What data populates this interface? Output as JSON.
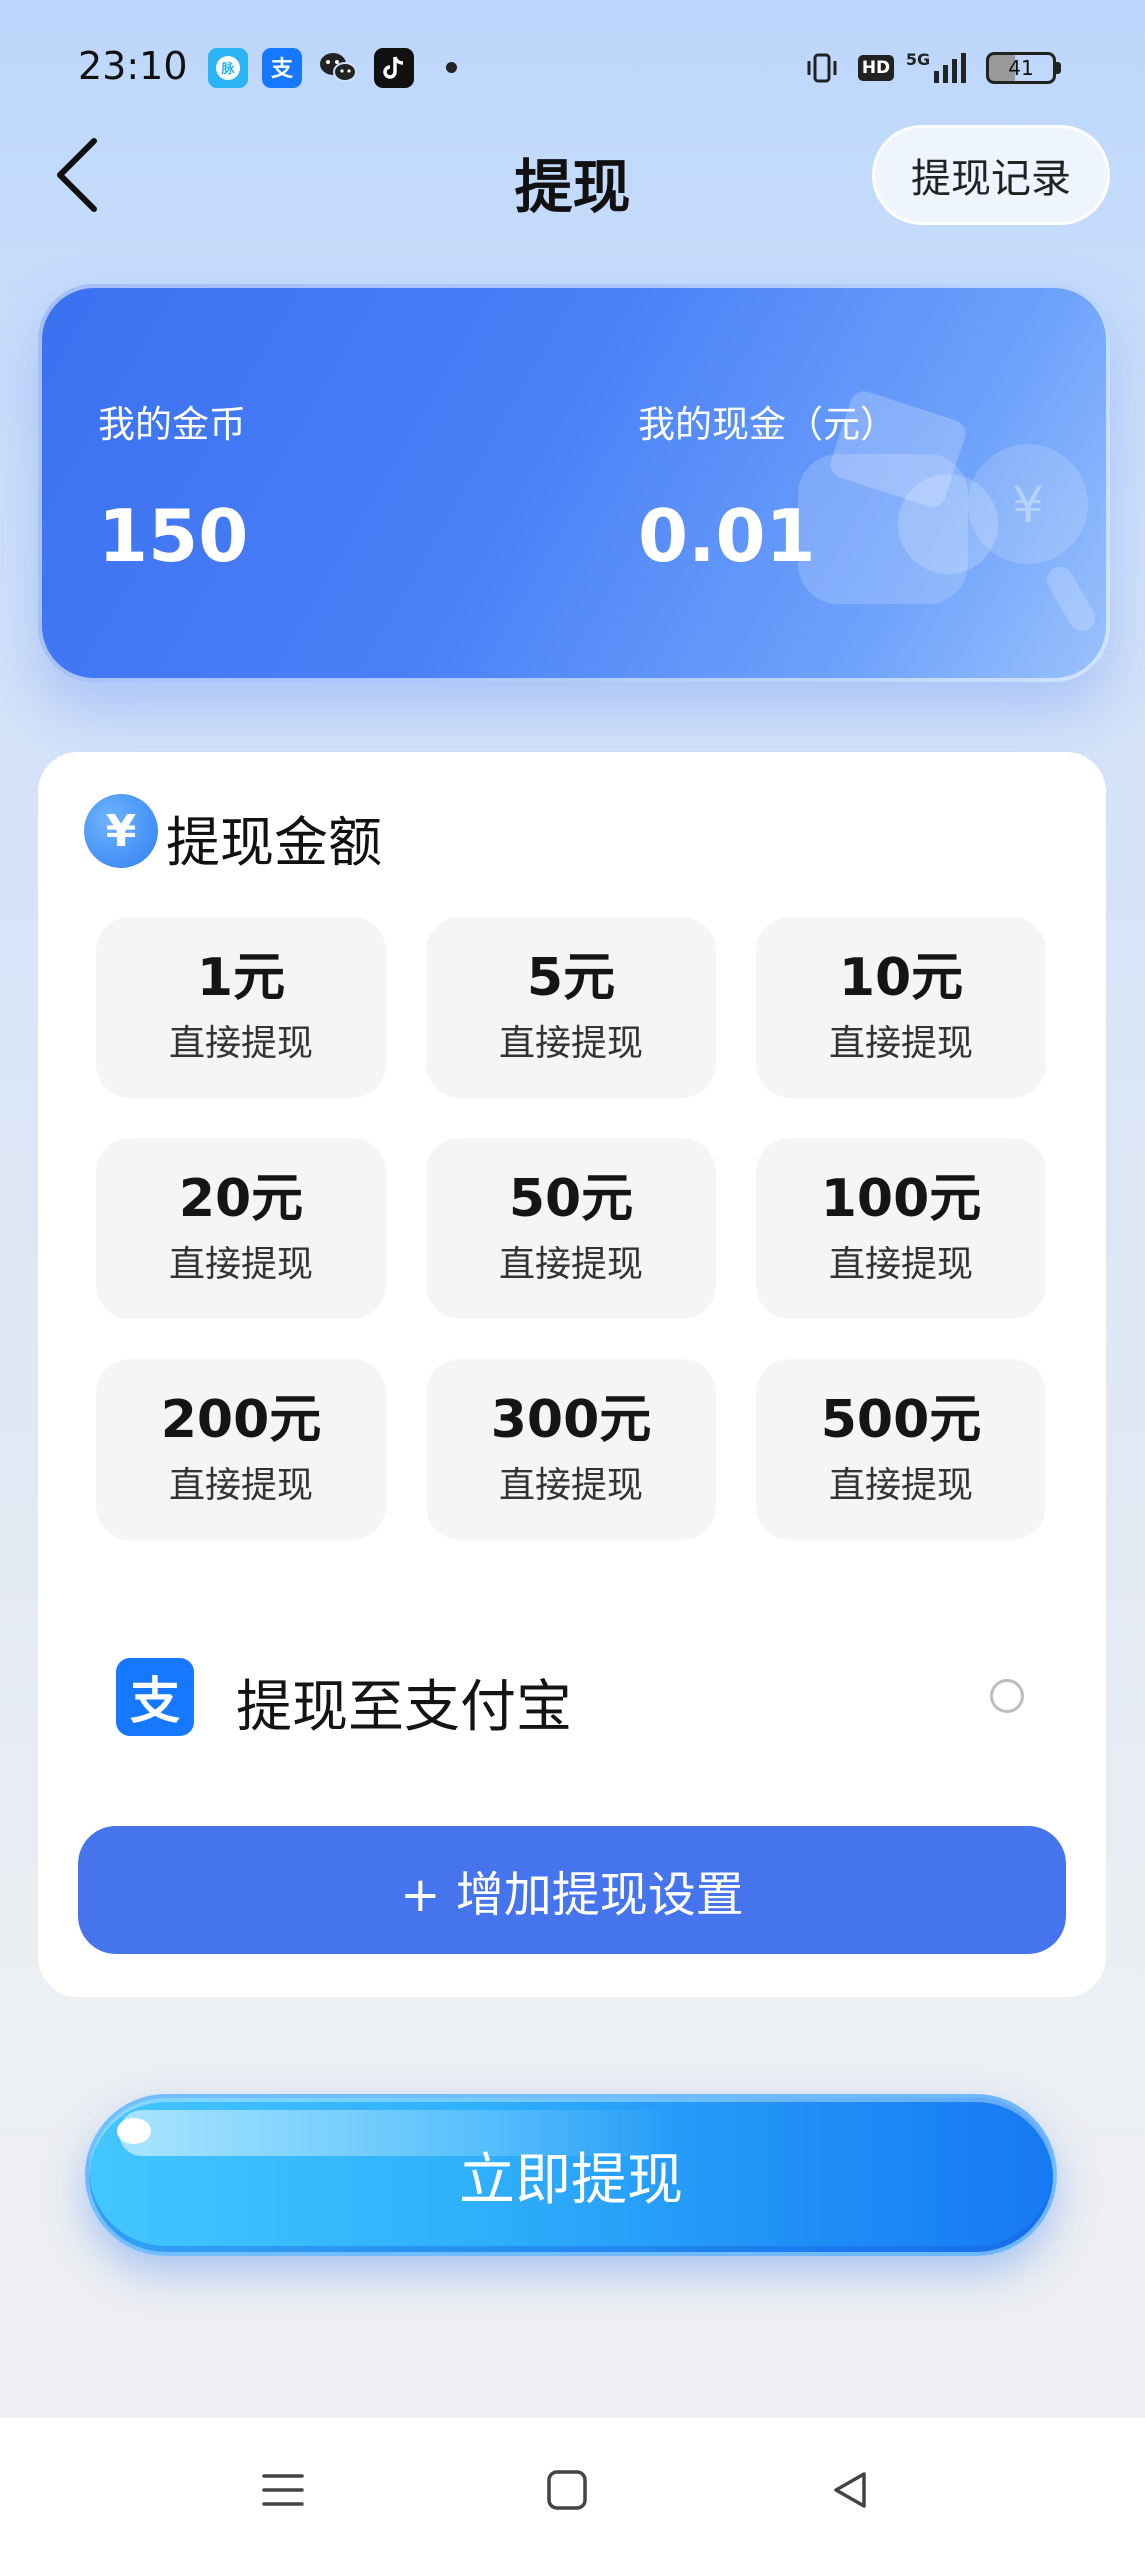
{
  "status_bar": {
    "time": "23:10",
    "app_icons": [
      "maimai-icon",
      "alipay-icon",
      "wechat-icon",
      "tiktok-icon"
    ],
    "network": "5G",
    "hd": "HD",
    "battery": "41"
  },
  "header": {
    "title": "提现",
    "record_button": "提现记录"
  },
  "balance": {
    "coins_label": "我的金币",
    "coins_value": "150",
    "cash_label": "我的现金（元）",
    "cash_value": "0.01"
  },
  "amount_section": {
    "icon_glyph": "¥",
    "title": "提现金额",
    "options": [
      {
        "amount": "1元",
        "note": "直接提现"
      },
      {
        "amount": "5元",
        "note": "直接提现"
      },
      {
        "amount": "10元",
        "note": "直接提现"
      },
      {
        "amount": "20元",
        "note": "直接提现"
      },
      {
        "amount": "50元",
        "note": "直接提现"
      },
      {
        "amount": "100元",
        "note": "直接提现"
      },
      {
        "amount": "200元",
        "note": "直接提现"
      },
      {
        "amount": "300元",
        "note": "直接提现"
      },
      {
        "amount": "500元",
        "note": "直接提现"
      }
    ]
  },
  "payment": {
    "method_label": "提现至支付宝",
    "selected": false,
    "logo_glyph": "支",
    "add_setting_button": "+ 增加提现设置"
  },
  "withdraw_button": "立即提现",
  "colors": {
    "primary": "#4674ec",
    "card_blue": "#3b70f0",
    "alipay_blue": "#1677ff",
    "button_cyan": "#2fb0fb"
  }
}
